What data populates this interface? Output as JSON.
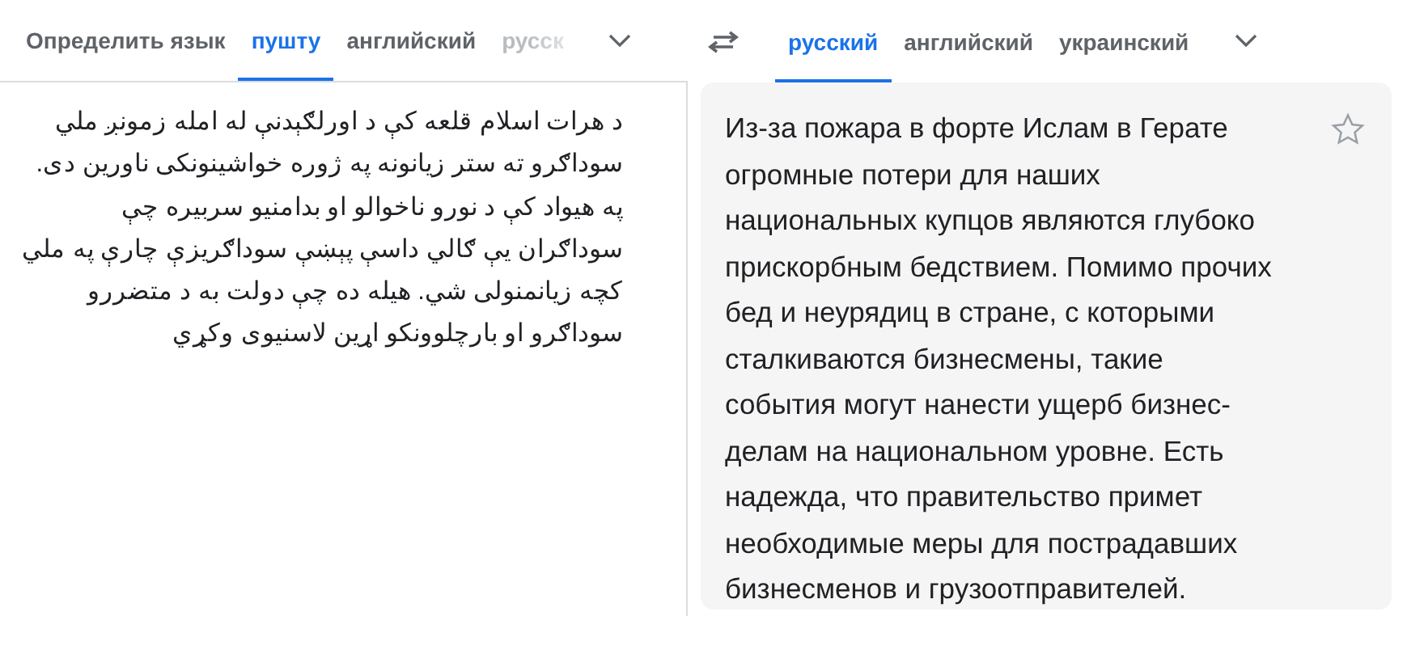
{
  "source_tabs": [
    {
      "label": "Определить язык",
      "selected": false,
      "faded": false
    },
    {
      "label": "пушту",
      "selected": true,
      "faded": false
    },
    {
      "label": "английский",
      "selected": false,
      "faded": false
    },
    {
      "label": "русск",
      "selected": false,
      "faded": true
    }
  ],
  "target_tabs": [
    {
      "label": "русский",
      "selected": true
    },
    {
      "label": "английский",
      "selected": false
    },
    {
      "label": "украинский",
      "selected": false
    }
  ],
  "source_text": [
    "د هرات اسلام قلعه کې د اورلګېدنې له امله زمونږ ملي",
    "سوداګرو ته ستر زيانونه په ژوره خواشينونکی ناورين دی.",
    "په هيواد کې د نورو ناخوالو او بدامنيو سربيره چې",
    "سوداګران يې ګالي داسې پېښې سوداګريزې چارې په ملي",
    "کچه زيانمنولی شي. هيله ده چې دولت به د متضررو",
    "سوداګرو او بارچلوونکو اړين لاسنيوی وکړي"
  ],
  "translation": [
    "Из-за пожара в форте Ислам в Герате",
    "огромные потери для наших",
    "национальных купцов являются глубоко",
    "прискорбным бедствием. Помимо прочих",
    "бед и неурядиц в стране, с которыми",
    "сталкиваются бизнесмены, такие",
    "события могут нанести ущерб бизнес-",
    "делам на национальном уровне. Есть",
    "надежда, что правительство примет",
    "необходимые меры для пострадавших",
    "бизнесменов и грузоотправителей."
  ],
  "saved": false
}
